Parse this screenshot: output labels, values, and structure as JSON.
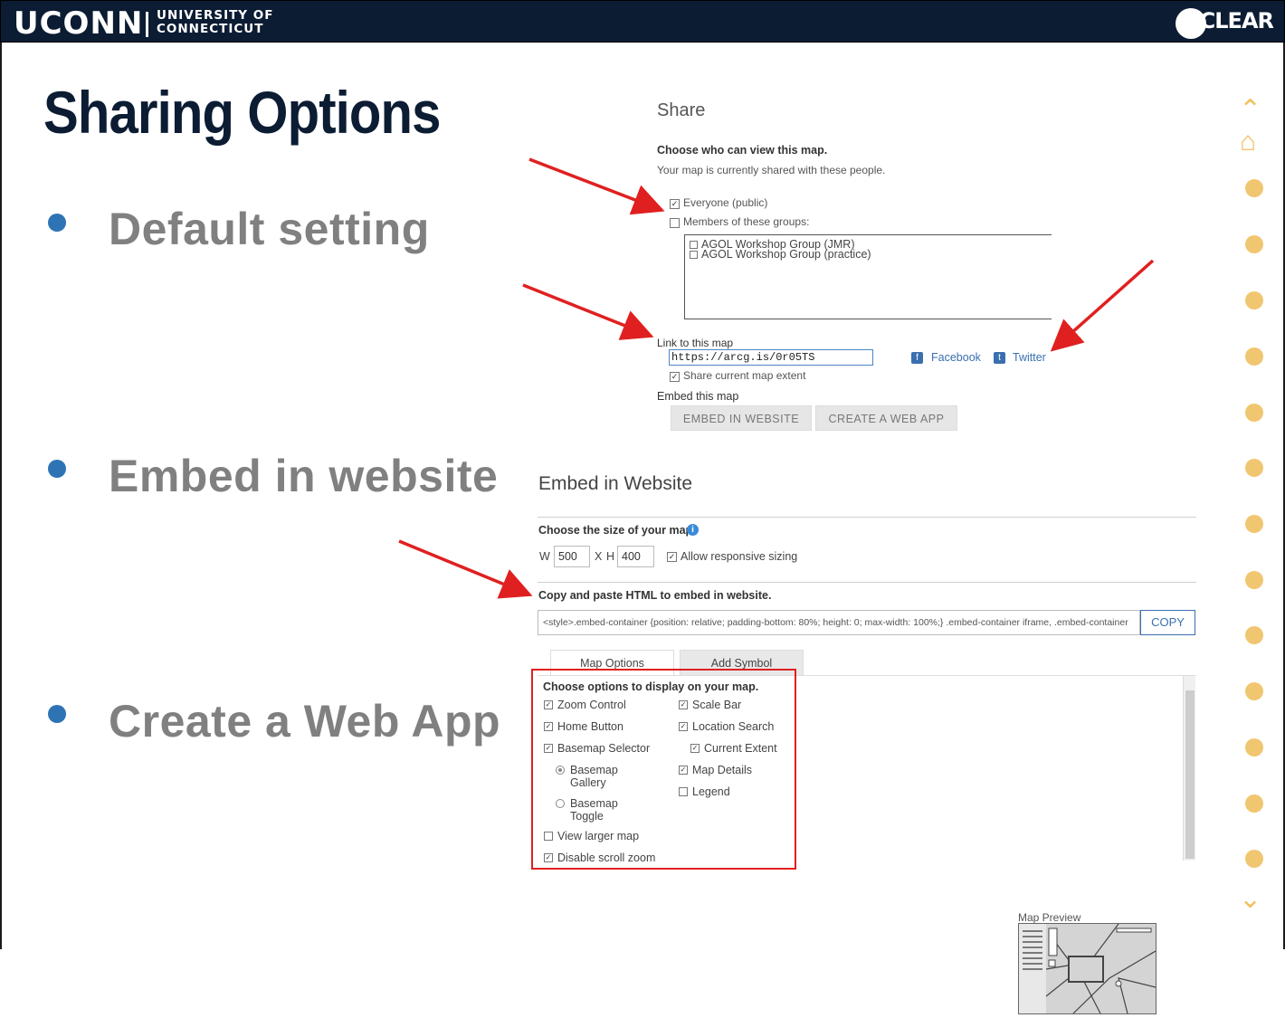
{
  "header": {
    "brand": "UCONN",
    "university_line1": "UNIVERSITY OF",
    "university_line2": "CONNECTICUT",
    "program": "CLEAR"
  },
  "slide": {
    "title": "Sharing Options",
    "bullets": [
      "Default setting",
      "Embed in website",
      "Create a Web App"
    ]
  },
  "share_panel": {
    "title": "Share",
    "choose_label": "Choose who can view this map.",
    "shared_with_text": "Your map is currently shared with these people.",
    "everyone_label": "Everyone (public)",
    "everyone_checked": true,
    "members_label": "Members of these groups:",
    "members_checked": false,
    "groups": [
      "AGOL Workshop Group (JMR)",
      "AGOL Workshop Group (practice)"
    ],
    "link_label": "Link to this map",
    "link_value": "https://arcg.is/0r05TS",
    "facebook_label": "Facebook",
    "twitter_label": "Twitter",
    "share_extent_label": "Share current map extent",
    "share_extent_checked": true,
    "embed_label": "Embed this map",
    "embed_button": "EMBED IN WEBSITE",
    "webapp_button": "CREATE A WEB APP"
  },
  "embed_panel": {
    "title": "Embed in Website",
    "size_label": "Choose the size of your map.",
    "w_label": "W",
    "width_value": "500",
    "x_label": "X",
    "h_label": "H",
    "height_value": "400",
    "responsive_label": "Allow responsive sizing",
    "responsive_checked": true,
    "copy_label": "Copy and paste HTML to embed in website.",
    "html_code": "<style>.embed-container {position: relative; padding-bottom: 80%; height: 0; max-width: 100%;} .embed-container iframe, .embed-container",
    "copy_button": "COPY",
    "tabs": [
      "Map Options",
      "Add Symbol"
    ],
    "options_heading": "Choose options to display on your map.",
    "options_left": [
      {
        "label": "Zoom Control",
        "checked": true
      },
      {
        "label": "Home Button",
        "checked": true
      },
      {
        "label": "Basemap Selector",
        "checked": true
      }
    ],
    "radio_gallery": [
      "Basemap",
      "Gallery"
    ],
    "radio_toggle": [
      "Basemap",
      "Toggle"
    ],
    "options_left_bottom": [
      {
        "label": "View larger map",
        "checked": false
      },
      {
        "label": "Disable scroll zoom",
        "checked": true
      }
    ],
    "options_right": [
      {
        "label": "Scale Bar",
        "checked": true
      },
      {
        "label": "Location Search",
        "checked": true
      },
      {
        "label": "Current Extent",
        "checked": true
      },
      {
        "label": "Map Details",
        "checked": true
      },
      {
        "label": "Legend",
        "checked": false
      }
    ],
    "preview_label": "Map Preview"
  },
  "colors": {
    "navy": "#0b1c33",
    "bullet_blue": "#2e74b5",
    "arrow_red": "#e02020",
    "link_blue": "#3a6fb0",
    "side_gold": "#f0c060"
  }
}
